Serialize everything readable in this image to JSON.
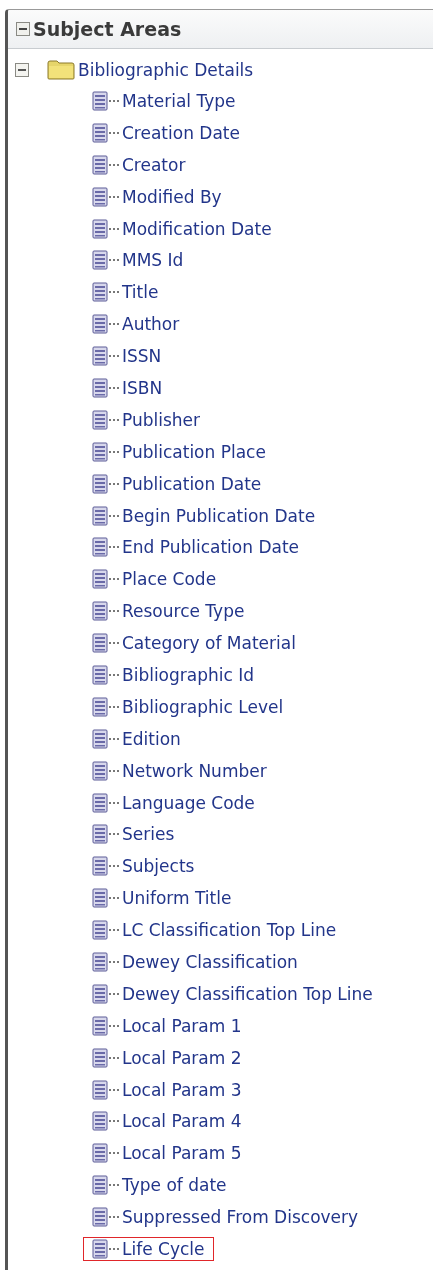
{
  "panel": {
    "title": "Subject Areas",
    "expanded": true
  },
  "folder": {
    "label": "Bibliographic Details",
    "expanded": true
  },
  "items": [
    {
      "label": "Material Type",
      "highlighted": false
    },
    {
      "label": "Creation Date",
      "highlighted": false
    },
    {
      "label": "Creator",
      "highlighted": false
    },
    {
      "label": "Modified By",
      "highlighted": false
    },
    {
      "label": "Modification Date",
      "highlighted": false
    },
    {
      "label": "MMS Id",
      "highlighted": false
    },
    {
      "label": "Title",
      "highlighted": false
    },
    {
      "label": "Author",
      "highlighted": false
    },
    {
      "label": "ISSN",
      "highlighted": false
    },
    {
      "label": "ISBN",
      "highlighted": false
    },
    {
      "label": "Publisher",
      "highlighted": false
    },
    {
      "label": "Publication Place",
      "highlighted": false
    },
    {
      "label": "Publication Date",
      "highlighted": false
    },
    {
      "label": "Begin Publication Date",
      "highlighted": false
    },
    {
      "label": "End Publication Date",
      "highlighted": false
    },
    {
      "label": "Place Code",
      "highlighted": false
    },
    {
      "label": "Resource Type",
      "highlighted": false
    },
    {
      "label": "Category of Material",
      "highlighted": false
    },
    {
      "label": "Bibliographic Id",
      "highlighted": false
    },
    {
      "label": "Bibliographic Level",
      "highlighted": false
    },
    {
      "label": "Edition",
      "highlighted": false
    },
    {
      "label": "Network Number",
      "highlighted": false
    },
    {
      "label": "Language Code",
      "highlighted": false
    },
    {
      "label": "Series",
      "highlighted": false
    },
    {
      "label": "Subjects",
      "highlighted": false
    },
    {
      "label": "Uniform Title",
      "highlighted": false
    },
    {
      "label": "LC Classification Top Line",
      "highlighted": false
    },
    {
      "label": "Dewey Classification",
      "highlighted": false
    },
    {
      "label": "Dewey Classification Top Line",
      "highlighted": false
    },
    {
      "label": "Local Param 1",
      "highlighted": false
    },
    {
      "label": "Local Param 2",
      "highlighted": false
    },
    {
      "label": "Local Param 3",
      "highlighted": false
    },
    {
      "label": "Local Param 4",
      "highlighted": false
    },
    {
      "label": "Local Param 5",
      "highlighted": false
    },
    {
      "label": "Type of date",
      "highlighted": false
    },
    {
      "label": "Suppressed From Discovery",
      "highlighted": false
    },
    {
      "label": "Life Cycle",
      "highlighted": true
    }
  ]
}
